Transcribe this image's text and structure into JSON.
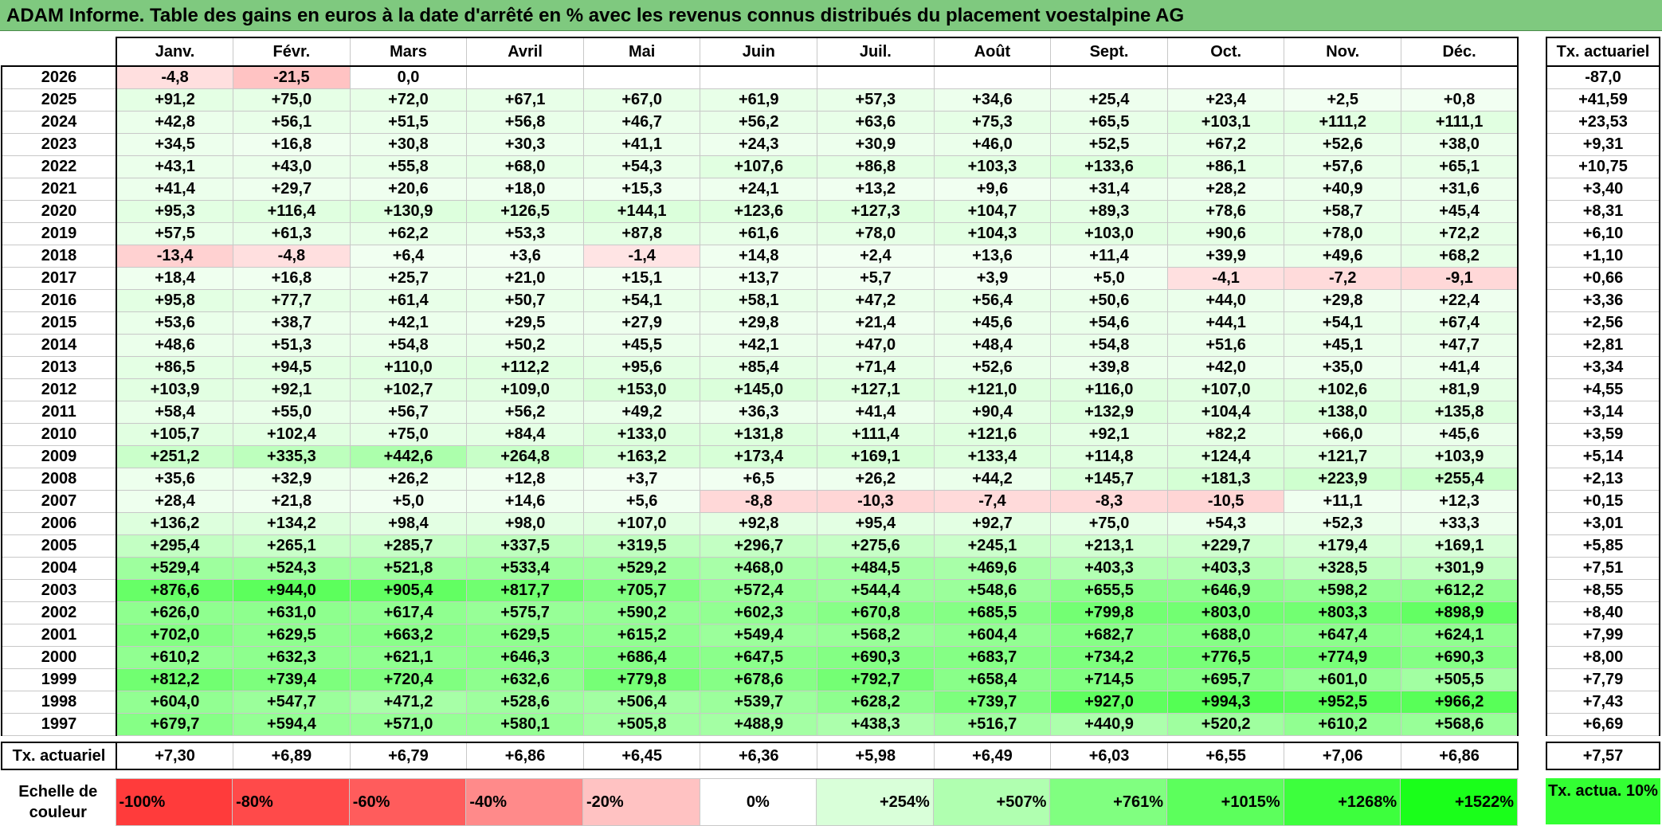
{
  "title": "ADAM Informe. Table des gains en euros à la date d'arrêté en % avec les revenus connus distribués du placement voestalpine AG",
  "months": [
    "Janv.",
    "Févr.",
    "Mars",
    "Avril",
    "Mai",
    "Juin",
    "Juil.",
    "Août",
    "Sept.",
    "Oct.",
    "Nov.",
    "Déc."
  ],
  "side_header": "Tx. actuariel",
  "rows": [
    {
      "year": "2026",
      "values": [
        "-4,8",
        "-21,5",
        "0,0",
        "",
        "",
        "",
        "",
        "",
        "",
        "",
        "",
        ""
      ],
      "rate": "-87,0"
    },
    {
      "year": "2025",
      "values": [
        "+91,2",
        "+75,0",
        "+72,0",
        "+67,1",
        "+67,0",
        "+61,9",
        "+57,3",
        "+34,6",
        "+25,4",
        "+23,4",
        "+2,5",
        "+0,8"
      ],
      "rate": "+41,59"
    },
    {
      "year": "2024",
      "values": [
        "+42,8",
        "+56,1",
        "+51,5",
        "+56,8",
        "+46,7",
        "+56,2",
        "+63,6",
        "+75,3",
        "+65,5",
        "+103,1",
        "+111,2",
        "+111,1"
      ],
      "rate": "+23,53"
    },
    {
      "year": "2023",
      "values": [
        "+34,5",
        "+16,8",
        "+30,8",
        "+30,3",
        "+41,1",
        "+24,3",
        "+30,9",
        "+46,0",
        "+52,5",
        "+67,2",
        "+52,6",
        "+38,0"
      ],
      "rate": "+9,31"
    },
    {
      "year": "2022",
      "values": [
        "+43,1",
        "+43,0",
        "+55,8",
        "+68,0",
        "+54,3",
        "+107,6",
        "+86,8",
        "+103,3",
        "+133,6",
        "+86,1",
        "+57,6",
        "+65,1"
      ],
      "rate": "+10,75"
    },
    {
      "year": "2021",
      "values": [
        "+41,4",
        "+29,7",
        "+20,6",
        "+18,0",
        "+15,3",
        "+24,1",
        "+13,2",
        "+9,6",
        "+31,4",
        "+28,2",
        "+40,9",
        "+31,6"
      ],
      "rate": "+3,40"
    },
    {
      "year": "2020",
      "values": [
        "+95,3",
        "+116,4",
        "+130,9",
        "+126,5",
        "+144,1",
        "+123,6",
        "+127,3",
        "+104,7",
        "+89,3",
        "+78,6",
        "+58,7",
        "+45,4"
      ],
      "rate": "+8,31"
    },
    {
      "year": "2019",
      "values": [
        "+57,5",
        "+61,3",
        "+62,2",
        "+53,3",
        "+87,8",
        "+61,6",
        "+78,0",
        "+104,3",
        "+103,0",
        "+90,6",
        "+78,0",
        "+72,2"
      ],
      "rate": "+6,10"
    },
    {
      "year": "2018",
      "values": [
        "-13,4",
        "-4,8",
        "+6,4",
        "+3,6",
        "-1,4",
        "+14,8",
        "+2,4",
        "+13,6",
        "+11,4",
        "+39,9",
        "+49,6",
        "+68,2"
      ],
      "rate": "+1,10"
    },
    {
      "year": "2017",
      "values": [
        "+18,4",
        "+16,8",
        "+25,7",
        "+21,0",
        "+15,1",
        "+13,7",
        "+5,7",
        "+3,9",
        "+5,0",
        "-4,1",
        "-7,2",
        "-9,1"
      ],
      "rate": "+0,66"
    },
    {
      "year": "2016",
      "values": [
        "+95,8",
        "+77,7",
        "+61,4",
        "+50,7",
        "+54,1",
        "+58,1",
        "+47,2",
        "+56,4",
        "+50,6",
        "+44,0",
        "+29,8",
        "+22,4"
      ],
      "rate": "+3,36"
    },
    {
      "year": "2015",
      "values": [
        "+53,6",
        "+38,7",
        "+42,1",
        "+29,5",
        "+27,9",
        "+29,8",
        "+21,4",
        "+45,6",
        "+54,6",
        "+44,1",
        "+54,1",
        "+67,4"
      ],
      "rate": "+2,56"
    },
    {
      "year": "2014",
      "values": [
        "+48,6",
        "+51,3",
        "+54,8",
        "+50,2",
        "+45,5",
        "+42,1",
        "+47,0",
        "+48,4",
        "+54,8",
        "+51,6",
        "+45,1",
        "+47,7"
      ],
      "rate": "+2,81"
    },
    {
      "year": "2013",
      "values": [
        "+86,5",
        "+94,5",
        "+110,0",
        "+112,2",
        "+95,6",
        "+85,4",
        "+71,4",
        "+52,6",
        "+39,8",
        "+42,0",
        "+35,0",
        "+41,4"
      ],
      "rate": "+3,34"
    },
    {
      "year": "2012",
      "values": [
        "+103,9",
        "+92,1",
        "+102,7",
        "+109,0",
        "+153,0",
        "+145,0",
        "+127,1",
        "+121,0",
        "+116,0",
        "+107,0",
        "+102,6",
        "+81,9"
      ],
      "rate": "+4,55"
    },
    {
      "year": "2011",
      "values": [
        "+58,4",
        "+55,0",
        "+56,7",
        "+56,2",
        "+49,2",
        "+36,3",
        "+41,4",
        "+90,4",
        "+132,9",
        "+104,4",
        "+138,0",
        "+135,8"
      ],
      "rate": "+3,14"
    },
    {
      "year": "2010",
      "values": [
        "+105,7",
        "+102,4",
        "+75,0",
        "+84,4",
        "+133,0",
        "+131,8",
        "+111,4",
        "+121,6",
        "+92,1",
        "+82,2",
        "+66,0",
        "+45,6"
      ],
      "rate": "+3,59"
    },
    {
      "year": "2009",
      "values": [
        "+251,2",
        "+335,3",
        "+442,6",
        "+264,8",
        "+163,2",
        "+173,4",
        "+169,1",
        "+133,4",
        "+114,8",
        "+124,4",
        "+121,7",
        "+103,9"
      ],
      "rate": "+5,14"
    },
    {
      "year": "2008",
      "values": [
        "+35,6",
        "+32,9",
        "+26,2",
        "+12,8",
        "+3,7",
        "+6,5",
        "+26,2",
        "+44,2",
        "+145,7",
        "+181,3",
        "+223,9",
        "+255,4"
      ],
      "rate": "+2,13"
    },
    {
      "year": "2007",
      "values": [
        "+28,4",
        "+21,8",
        "+5,0",
        "+14,6",
        "+5,6",
        "-8,8",
        "-10,3",
        "-7,4",
        "-8,3",
        "-10,5",
        "+11,1",
        "+12,3"
      ],
      "rate": "+0,15"
    },
    {
      "year": "2006",
      "values": [
        "+136,2",
        "+134,2",
        "+98,4",
        "+98,0",
        "+107,0",
        "+92,8",
        "+95,4",
        "+92,7",
        "+75,0",
        "+54,3",
        "+52,3",
        "+33,3"
      ],
      "rate": "+3,01"
    },
    {
      "year": "2005",
      "values": [
        "+295,4",
        "+265,1",
        "+285,7",
        "+337,5",
        "+319,5",
        "+296,7",
        "+275,6",
        "+245,1",
        "+213,1",
        "+229,7",
        "+179,4",
        "+169,1"
      ],
      "rate": "+5,85"
    },
    {
      "year": "2004",
      "values": [
        "+529,4",
        "+524,3",
        "+521,8",
        "+533,4",
        "+529,2",
        "+468,0",
        "+484,5",
        "+469,6",
        "+403,3",
        "+403,3",
        "+328,5",
        "+301,9"
      ],
      "rate": "+7,51"
    },
    {
      "year": "2003",
      "values": [
        "+876,6",
        "+944,0",
        "+905,4",
        "+817,7",
        "+705,7",
        "+572,4",
        "+544,4",
        "+548,6",
        "+655,5",
        "+646,9",
        "+598,2",
        "+612,2"
      ],
      "rate": "+8,55"
    },
    {
      "year": "2002",
      "values": [
        "+626,0",
        "+631,0",
        "+617,4",
        "+575,7",
        "+590,2",
        "+602,3",
        "+670,8",
        "+685,5",
        "+799,8",
        "+803,0",
        "+803,3",
        "+898,9"
      ],
      "rate": "+8,40"
    },
    {
      "year": "2001",
      "values": [
        "+702,0",
        "+629,5",
        "+663,2",
        "+629,5",
        "+615,2",
        "+549,4",
        "+568,2",
        "+604,4",
        "+682,7",
        "+688,0",
        "+647,4",
        "+624,1"
      ],
      "rate": "+7,99"
    },
    {
      "year": "2000",
      "values": [
        "+610,2",
        "+632,3",
        "+621,1",
        "+646,3",
        "+686,4",
        "+647,5",
        "+690,3",
        "+683,7",
        "+734,2",
        "+776,5",
        "+774,9",
        "+690,3"
      ],
      "rate": "+8,00"
    },
    {
      "year": "1999",
      "values": [
        "+812,2",
        "+739,4",
        "+720,4",
        "+632,6",
        "+779,8",
        "+678,6",
        "+792,7",
        "+658,4",
        "+714,5",
        "+695,7",
        "+601,0",
        "+505,5"
      ],
      "rate": "+7,79"
    },
    {
      "year": "1998",
      "values": [
        "+604,0",
        "+547,7",
        "+471,2",
        "+528,6",
        "+506,4",
        "+539,7",
        "+628,2",
        "+739,7",
        "+927,0",
        "+994,3",
        "+952,5",
        "+966,2"
      ],
      "rate": "+7,43"
    },
    {
      "year": "1997",
      "values": [
        "+679,7",
        "+594,4",
        "+571,0",
        "+580,1",
        "+505,8",
        "+488,9",
        "+438,3",
        "+516,7",
        "+440,9",
        "+520,2",
        "+610,2",
        "+568,6"
      ],
      "rate": "+6,69"
    }
  ],
  "footer": {
    "label": "Tx. actuariel",
    "values": [
      "+7,30",
      "+6,89",
      "+6,79",
      "+6,86",
      "+6,45",
      "+6,36",
      "+5,98",
      "+6,49",
      "+6,03",
      "+6,55",
      "+7,06",
      "+6,86"
    ],
    "rate": "+7,57"
  },
  "scale": {
    "label": "Echelle de couleur",
    "steps": [
      {
        "label": "-100%",
        "color": "#ff3b3b",
        "align": "left"
      },
      {
        "label": "-80%",
        "color": "#ff4a4a",
        "align": "left"
      },
      {
        "label": "-60%",
        "color": "#ff5c5c",
        "align": "left"
      },
      {
        "label": "-40%",
        "color": "#ff8a8a",
        "align": "left"
      },
      {
        "label": "-20%",
        "color": "#ffc2c2",
        "align": "left"
      },
      {
        "label": "0%",
        "color": "#ffffff",
        "align": "center"
      },
      {
        "label": "+254%",
        "color": "#d9ffd9",
        "align": "right"
      },
      {
        "label": "+507%",
        "color": "#b0ffb0",
        "align": "right"
      },
      {
        "label": "+761%",
        "color": "#80ff80",
        "align": "right"
      },
      {
        "label": "+1015%",
        "color": "#5cff5c",
        "align": "right"
      },
      {
        "label": "+1268%",
        "color": "#3dff3d",
        "align": "right"
      },
      {
        "label": "+1522%",
        "color": "#1aff1a",
        "align": "right"
      }
    ],
    "side_label": "Tx. actua. 10%"
  },
  "colors": {
    "title_bg": "#7fc97f",
    "positive": "#00ff00",
    "negative": "#ff3333"
  }
}
